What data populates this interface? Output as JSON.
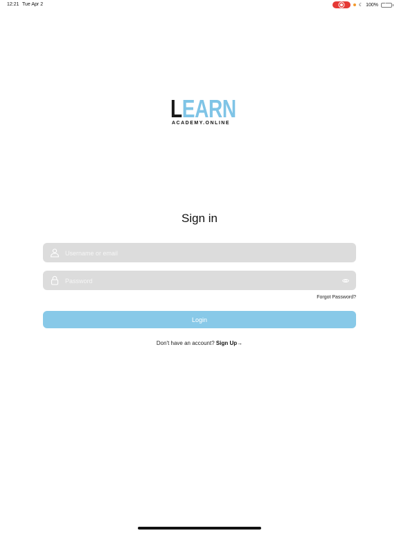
{
  "status_bar": {
    "time": "12:21",
    "date": "Tue Apr 2",
    "battery": "100%",
    "recording_color": "#e53935",
    "battery_color": "#34c759"
  },
  "logo": {
    "first_letter": "L",
    "rest": "EARN",
    "subtitle": "ACADEMY.ONLINE",
    "accent_color": "#7fc4e6"
  },
  "form": {
    "title": "Sign in",
    "username_placeholder": "Username or email",
    "username_icon": "user-icon",
    "password_placeholder": "Password",
    "password_icon": "lock-icon",
    "visibility_icon": "eye-icon",
    "forgot_password": "Forgot Password?",
    "login_label": "Login",
    "login_color": "#88c9e8",
    "signup_prompt": "Don't have an account?",
    "signup_label": "Sign Up",
    "signup_arrow": "→"
  }
}
